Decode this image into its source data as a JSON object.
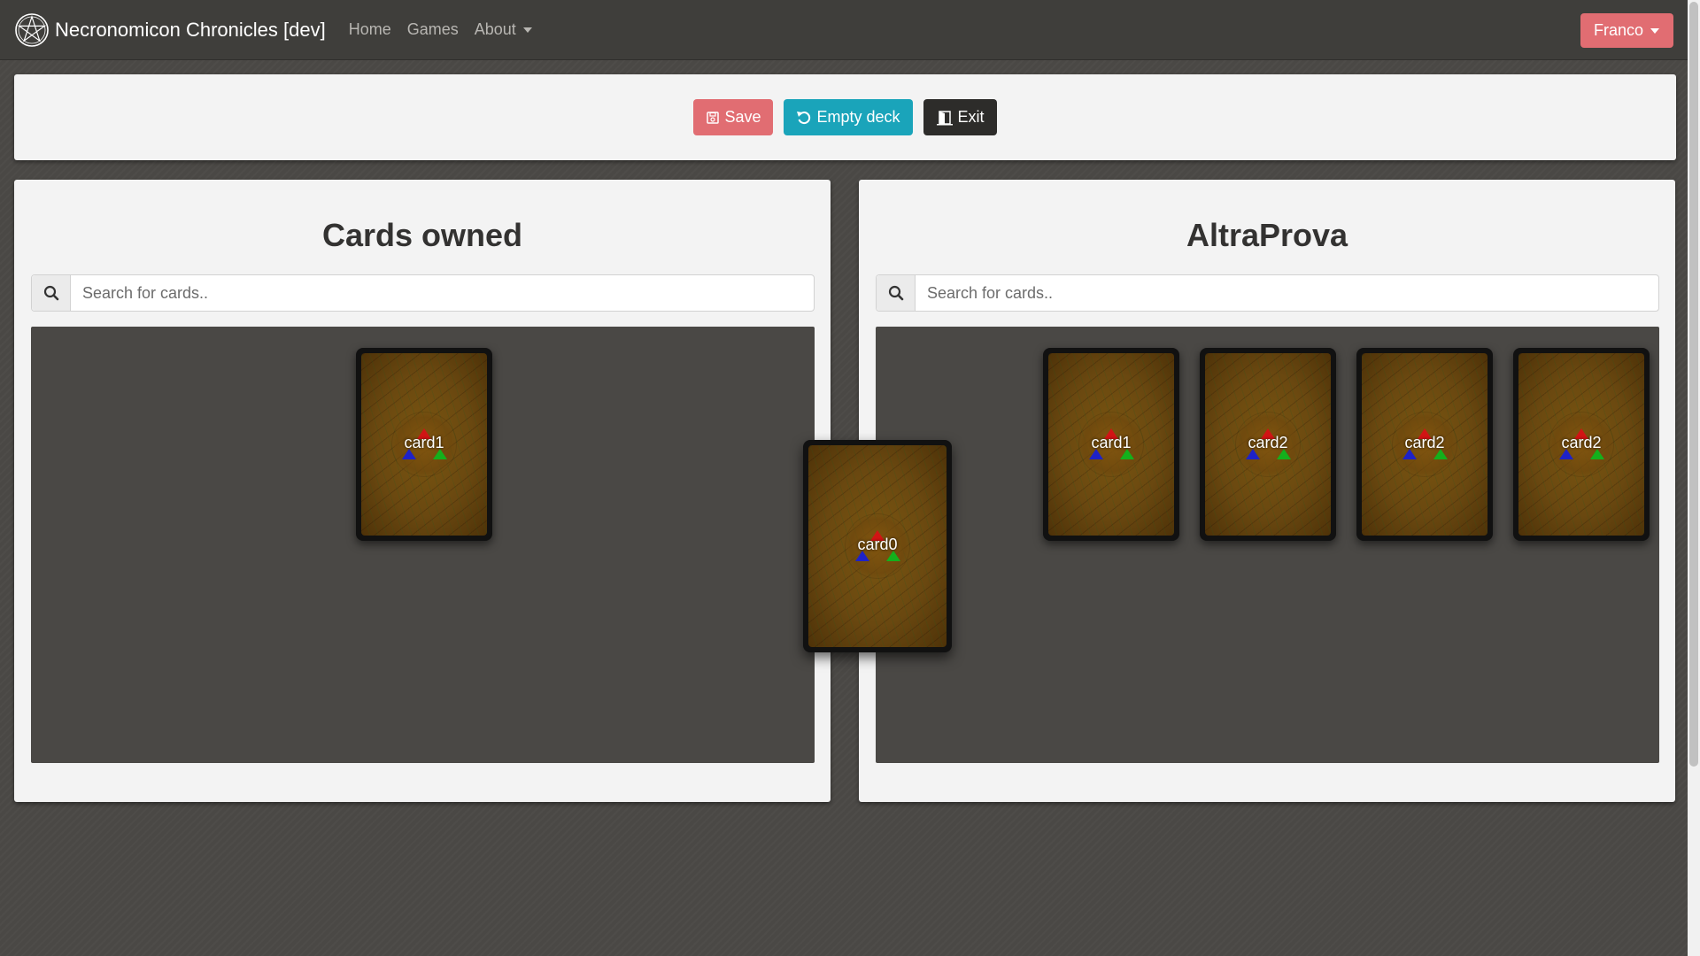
{
  "navbar": {
    "brand": "Necronomicon Chronicles [dev]",
    "links": [
      {
        "label": "Home"
      },
      {
        "label": "Games"
      },
      {
        "label": "About"
      }
    ],
    "user": "Franco"
  },
  "toolbar": {
    "save_label": "Save",
    "empty_label": "Empty deck",
    "exit_label": "Exit"
  },
  "owned": {
    "title": "Cards owned",
    "search_placeholder": "Search for cards..",
    "cards": [
      {
        "name": "card1"
      }
    ]
  },
  "deck": {
    "title": "AltraProva",
    "search_placeholder": "Search for cards..",
    "cards": [
      {
        "name": "card1"
      },
      {
        "name": "card2"
      },
      {
        "name": "card2"
      },
      {
        "name": "card2"
      }
    ]
  },
  "dragging": {
    "name": "card0"
  },
  "colors": {
    "accent_red": "#e16d72",
    "accent_teal": "#1aa4ba",
    "dark": "#2d2c2a"
  }
}
